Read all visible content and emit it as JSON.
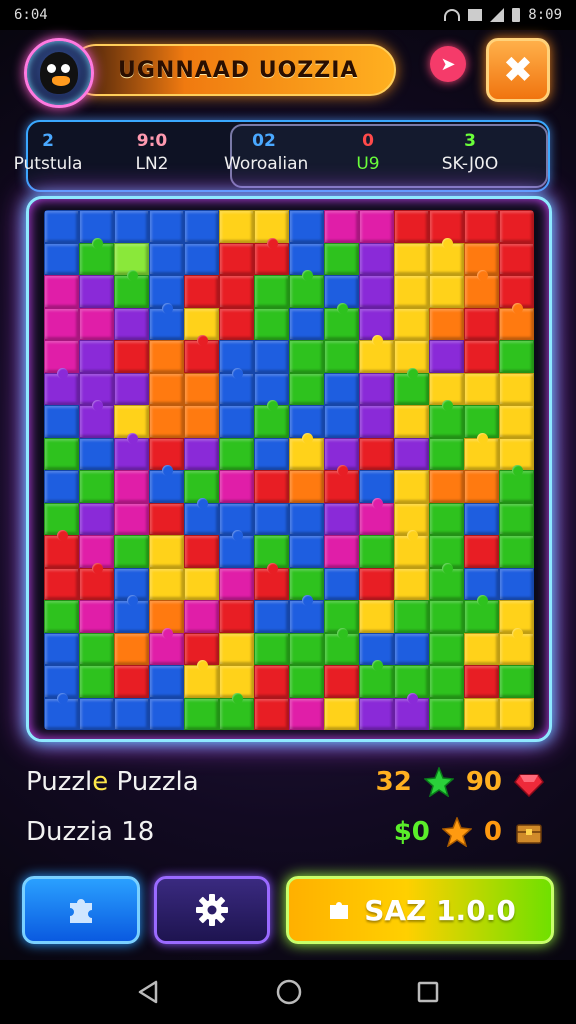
{
  "status_bar": {
    "time": "6:04",
    "right_text": "8:09"
  },
  "header": {
    "title": "UGNNAAD UOZZIA",
    "avatar_icon": "penguin-avatar",
    "bookmark_icon": "pin-icon",
    "close_icon": "close-icon"
  },
  "stats": {
    "left": [
      {
        "value": "2",
        "label": "Putstula",
        "color": "#4aa8ff"
      },
      {
        "value": "9:0",
        "label": "LN2",
        "color": "#ff9ab0"
      }
    ],
    "right": [
      {
        "value": "02",
        "label": "Woroalian",
        "color": "#4aa8ff"
      },
      {
        "value": "0",
        "label": "U9",
        "color": "#ff4a4a",
        "label_color": "#6aff3a"
      },
      {
        "value": "3",
        "label": "SK-J0O",
        "color": "#6aff3a"
      }
    ]
  },
  "board": {
    "columns": 14,
    "rows": 16,
    "palette": {
      "b": "#1e5ee0",
      "g": "#2ec21e",
      "r": "#e81e24",
      "y": "#ffd21a",
      "p": "#8a2ad8",
      "m": "#e01ea8",
      "o": "#ff7a10",
      "l": "#8ae83a",
      "c": "#2a9aff"
    },
    "grid": [
      "bbbbbyybmmrrrr",
      "bglbbrrbgpyyor",
      "mpgbrrggbpyyor",
      "mmpbyrgbgpyoro",
      "mprorbbggyyprg",
      "pppoobbgbpgyyy",
      "bpyoobgbbpyggy",
      "gbprpgbyprpgyy",
      "bgmbgmrorbyoog",
      "gpmrbbbbpmygbg",
      "rmgyrbgbmgygrg",
      "rrbyymrgbrygbb",
      "gmbomrbbgygggy",
      "bgomrygggbbgyy",
      "bgrbyyrgrgggrg",
      "bbbbggrmyppgyy"
    ]
  },
  "info": {
    "row1": {
      "label_a": "Puzzl",
      "label_hl": "e",
      "label_b": " Puzzla",
      "num1": "32",
      "num2": "90"
    },
    "row2": {
      "label": "Duzzia 18",
      "num1": "$0",
      "num2": "0"
    }
  },
  "buttons": {
    "puzzle_icon": "puzzle-icon",
    "settings_icon": "gear-icon",
    "save_label": "SAZ 1.0.0"
  },
  "navbar": {
    "back_icon": "back-icon",
    "home_icon": "home-icon",
    "recents_icon": "recents-icon"
  }
}
